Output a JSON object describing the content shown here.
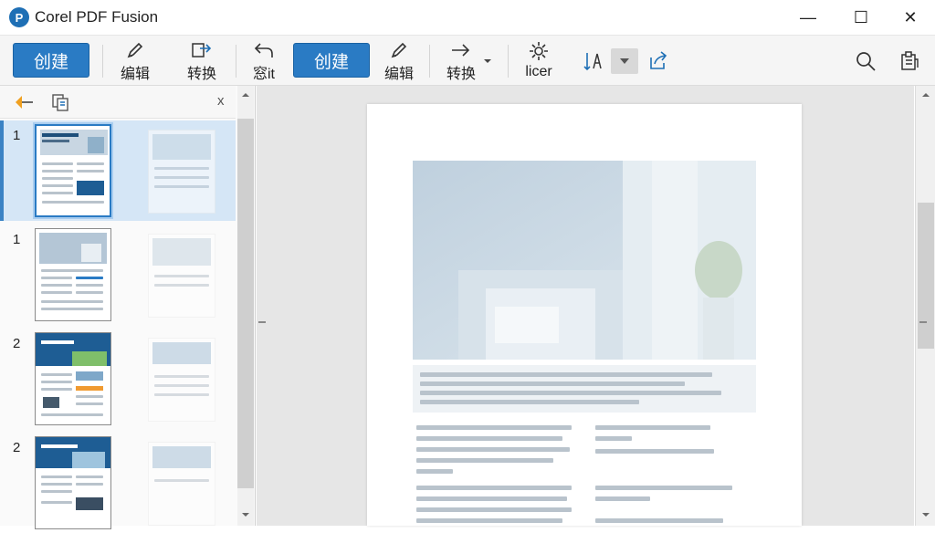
{
  "window": {
    "title": "Corel PDF Fusion",
    "logo_text": "P"
  },
  "window_controls": {
    "minimize": "—",
    "maximize": "☐",
    "close": "✕"
  },
  "toolbar": {
    "create_label": "创建",
    "edit_label": "编辑",
    "convert_label": "转换",
    "third_label": "窓it",
    "create2_label": "创建",
    "edit2_label": "编辑",
    "convert2_label": "转换",
    "licer_label": "licer"
  },
  "sidebar": {
    "close_label": "x",
    "pages": [
      {
        "number": "1",
        "selected": true
      },
      {
        "number": "1",
        "selected": false
      },
      {
        "number": "2",
        "selected": false
      },
      {
        "number": "2",
        "selected": false
      }
    ]
  },
  "colors": {
    "accent": "#2a7bc4",
    "selection": "#d5e6f6"
  }
}
